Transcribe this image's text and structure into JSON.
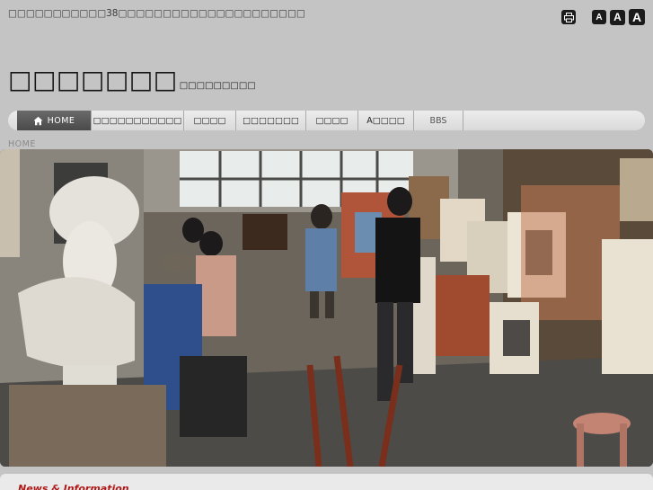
{
  "header": {
    "tagline": "□□□□□□□□□□□38□□□□□□□□□□□□□□□□□□□□□",
    "tools": {
      "print_icon": "printer-icon",
      "font_small": "A",
      "font_medium": "A",
      "font_large": "A"
    }
  },
  "logo": {
    "main": "□□□□□□□",
    "sub": "□□□□□□□□□"
  },
  "nav": {
    "items": [
      {
        "label": "HOME",
        "icon": "home-icon",
        "active": true
      },
      {
        "label": "□□□□□□□□□□□"
      },
      {
        "label": "□□□□"
      },
      {
        "label": "□□□□□□□"
      },
      {
        "label": "□□□□"
      },
      {
        "label": "A□□□□"
      },
      {
        "label": "BBS"
      }
    ]
  },
  "breadcrumb": "HOME",
  "hero": {
    "alt_scene": "art-studio-photo"
  },
  "news": {
    "title": "News & Information"
  },
  "colors": {
    "background": "#c4c4c4",
    "nav_active": "#555555",
    "news_title": "#b01818"
  }
}
